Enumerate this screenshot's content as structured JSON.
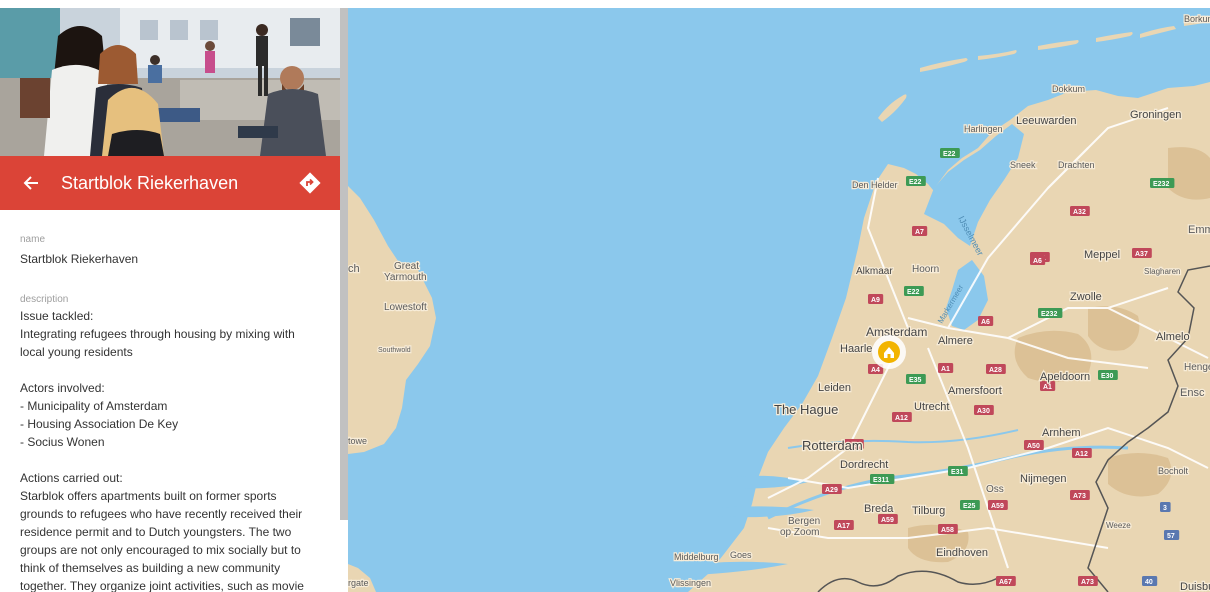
{
  "place": {
    "title": "Startblok Riekerhaven",
    "name_label": "name",
    "name_value": "Startblok Riekerhaven",
    "description_label": "description",
    "description_paragraphs": [
      [
        "Issue tackled:",
        "Integrating refugees through housing by mixing with",
        "local young residents"
      ],
      [
        "Actors involved:",
        "- Municipality of Amsterdam",
        "- Housing Association De Key",
        "- Socius Wonen"
      ],
      [
        "Actions carried out:",
        "Starblok offers apartments built on former sports",
        "grounds to refugees who have recently received their",
        "residence permit and to Dutch youngsters. The two",
        "groups are not only encouraged to mix socially but to",
        "think of themselves as building a new community",
        "together. They organize joint activities, such as movie"
      ]
    ]
  },
  "icons": {
    "back": "arrow-left-icon",
    "directions": "directions-icon",
    "marker": "home-icon"
  },
  "colors": {
    "header_red": "#db4437",
    "water": "#8bc8ec",
    "land": "#e9d6b3",
    "marker": "#f2b400"
  },
  "map": {
    "place_labels": {
      "borkum": "Borkum",
      "dokkum": "Dokkum",
      "groningen": "Groningen",
      "leeuwarden": "Leeuwarden",
      "harlingen": "Harlingen",
      "sneek": "Sneek",
      "drachten": "Drachten",
      "den_helder": "Den Helder",
      "ijsselmeer": "IJsselmeer",
      "markermeer": "Markermeer",
      "emm": "Emm",
      "meppel": "Meppel",
      "slagharen": "Slagharen",
      "alkmaar": "Alkmaar",
      "hoorn": "Hoorn",
      "zwolle": "Zwolle",
      "ch": "ch",
      "great_yarmouth_1": "Great",
      "great_yarmouth_2": "Yarmouth",
      "lowestoft": "Lowestoft",
      "southwold": "Southwold",
      "amsterdam": "Amsterdam",
      "almere": "Almere",
      "haarlem": "Haarle",
      "almelo": "Almelo",
      "hengelo": "Hengel",
      "apeldoorn": "Apeldoorn",
      "ensc": "Ensc",
      "leiden": "Leiden",
      "amersfoort": "Amersfoort",
      "the_hague": "The Hague",
      "utrecht": "Utrecht",
      "arnhem": "Arnhem",
      "towe": "towe",
      "rotterdam": "Rotterdam",
      "bocholt": "Bocholt",
      "nijmegen": "Nijmegen",
      "dordrecht": "Dordrecht",
      "oss": "Oss",
      "breda": "Breda",
      "tilburg": "Tilburg",
      "weeze": "Weeze",
      "bergen_1": "Bergen",
      "bergen_2": "op Zoom",
      "middelburg": "Middelburg",
      "goes": "Goes",
      "eindhoven": "Eindhoven",
      "vlissingen": "Vlissingen",
      "rgate": "rgate",
      "duisburg": "Duisbur"
    },
    "road_shields": [
      "E22",
      "E232",
      "A32",
      "A31",
      "A6",
      "A37",
      "A7",
      "E22",
      "A9",
      "E22",
      "E232",
      "A6",
      "A4",
      "E35",
      "A1",
      "A28",
      "A1",
      "E30",
      "A12",
      "A30",
      "A50",
      "A16",
      "E311",
      "E31",
      "A12",
      "A29",
      "A73",
      "E25",
      "A59",
      "A17",
      "A59",
      "A58",
      "A67",
      "A73",
      "3",
      "57",
      "40"
    ]
  }
}
